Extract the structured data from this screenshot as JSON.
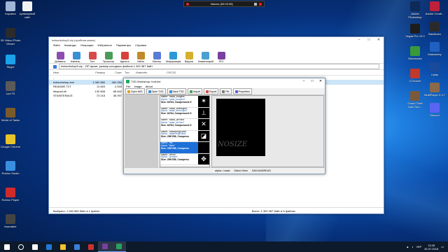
{
  "desktop_icons_left": [
    {
      "label": "Корзина",
      "color": "#9fb7d6"
    },
    {
      "label": "3D Vision Photo Viewer",
      "color": "#2b2b2b"
    },
    {
      "label": "Skype",
      "color": "#1aa3e8"
    },
    {
      "label": "Lyui ГК",
      "color": "#5a5a5a"
    },
    {
      "label": "World of Tanks",
      "color": "#7a5a2a"
    },
    {
      "label": "Google Chrome",
      "color": "#e8c42a"
    },
    {
      "label": "Roblox Studio",
      "color": "#3a8fe0"
    },
    {
      "label": "Roblox Player",
      "color": "#d02b2b"
    },
    {
      "label": "keymaker",
      "color": "#444444"
    }
  ],
  "desktop_icons_second": [
    {
      "label": "кулинарный сайт",
      "color": "#f2f2f2"
    }
  ],
  "desktop_icons_right_col1": [
    {
      "label": "Adobe Photoshop",
      "color": "#0d2a59"
    },
    {
      "label": "Vegas Pro 13.0",
      "color": "#1d1d1d"
    },
    {
      "label": "Bluestacks",
      "color": "#3a9a3a"
    },
    {
      "label": "CCleaner",
      "color": "#c0392b"
    },
    {
      "label": "Grand Theft Auto San...",
      "color": "#7a5a3a"
    }
  ],
  "desktop_icons_right_col2": [
    {
      "label": "Adobe Creati...",
      "color": "#c0203a"
    },
    {
      "label": "Bandicam",
      "color": "#2a2a2a"
    },
    {
      "label": "Malwareby",
      "color": "#2060c0"
    },
    {
      "label": "Uplay",
      "color": "#1a4a9a"
    },
    {
      "label": "MultiPlayer 0.3.7",
      "color": "#8a6a4a"
    },
    {
      "label": "Discord",
      "color": "#5865f2"
    }
  ],
  "recording_bar": {
    "text": "Запись [00:00:00]"
  },
  "winrar": {
    "title": "txdworkshop5.zip (пробная копия)",
    "menu": [
      "Файл",
      "Команды",
      "Операции",
      "Избранное",
      "Параметры",
      "Справка"
    ],
    "toolbar": [
      "Добавить",
      "Извлечь...",
      "Тест",
      "Просмотр",
      "Удалить",
      "Найти",
      "Мастер",
      "Информация",
      "Вирусы",
      "Комментарий",
      "SFX"
    ],
    "path": "txdworkshop5.zip - ZIP архив, размер исходных файлов 1 300 387 байт",
    "columns": [
      "Имя",
      "Размер",
      "Сжат",
      "Тип",
      "Изменён",
      "CRC32"
    ],
    "files": [
      {
        "name": "..",
        "size": "",
        "packed": "",
        "type": "",
        "selected": false
      },
      {
        "name": "txdworkshop.exe",
        "size": "1 082 880",
        "packed": "484 284",
        "type": "При",
        "selected": true
      },
      {
        "name": "README.TXT",
        "size": "11 663",
        "packed": "4 533",
        "type": "Тек",
        "selected": false
      },
      {
        "name": "libcpuid.dll",
        "size": "132 608",
        "packed": "68 642",
        "type": "Рас",
        "selected": false
      },
      {
        "name": "STAINTERACE.",
        "size": "73 218",
        "packed": "38 097",
        "type": "Рас",
        "selected": false
      }
    ],
    "status_left": "Выбрано: 1 082 880 байт в 1 файле",
    "status_right": "Всего: 1 300 387 байт в 5 файлах"
  },
  "txd": {
    "title": "TXD Workshop: hud.txd",
    "menu": [
      "File",
      "Image",
      "About"
    ],
    "toolbar": [
      "Open IMG",
      "Open TXD",
      "Save TXD",
      "Import",
      "Export",
      "Fltr",
      "Properties"
    ],
    "textures": [
      {
        "name": "Name: \"radar_burgers\"",
        "alpha": "Alpha: \"radar_burgerm\"",
        "size": "Size: 64*64, Compressed D",
        "glyph": "✶",
        "selected": false
      },
      {
        "name": "Name: \"radar_ammugun\"",
        "alpha": "Alpha: \"radar_ammugun\"",
        "size": "Size: 64*64, Compressed D",
        "glyph": "⟂",
        "selected": false
      },
      {
        "name": "Name: \"radar_airYard\"",
        "alpha": "Alpha: \"radar_airYard\"",
        "size": "Size: 64*64, Compressed D",
        "glyph": "✕",
        "selected": false
      },
      {
        "name": "Name: \"radarRingPlane\"",
        "alpha": "Alpha: \"radarRingPlane\"",
        "size": "Size: 256*256, Compress",
        "glyph": "◪",
        "selected": false
      },
      {
        "name": "Name: \"fist\"",
        "alpha": "Alpha: \"fistm\"",
        "size": "Size: 256*256, Compress",
        "glyph": "",
        "selected": true
      },
      {
        "name": "Name: \"arrow\"",
        "alpha": "Alpha: \"arrowm\"",
        "size": "Size: 256*256, Compress",
        "glyph": "✥",
        "selected": false
      }
    ],
    "preview_text": "NOSIZE",
    "status": [
      "alpha / mask",
      "Mixed View",
      "SAN ANDREAS"
    ]
  },
  "taskbar": {
    "icons": [
      {
        "name": "start",
        "color": "#ffffff"
      },
      {
        "name": "search",
        "color": "#ffffff"
      },
      {
        "name": "task-view",
        "color": "#ffffff"
      },
      {
        "name": "edge",
        "color": "#1e7ad6"
      },
      {
        "name": "explorer",
        "color": "#f2c230"
      },
      {
        "name": "store",
        "color": "#3b7fd6"
      },
      {
        "name": "bandicam",
        "color": "#d03030"
      },
      {
        "name": "winrar",
        "color": "#7a3fa0"
      },
      {
        "name": "txd-workshop",
        "color": "#2aa060"
      }
    ],
    "lang": "УКР",
    "time": "13:28",
    "date": "30.07.2018"
  }
}
